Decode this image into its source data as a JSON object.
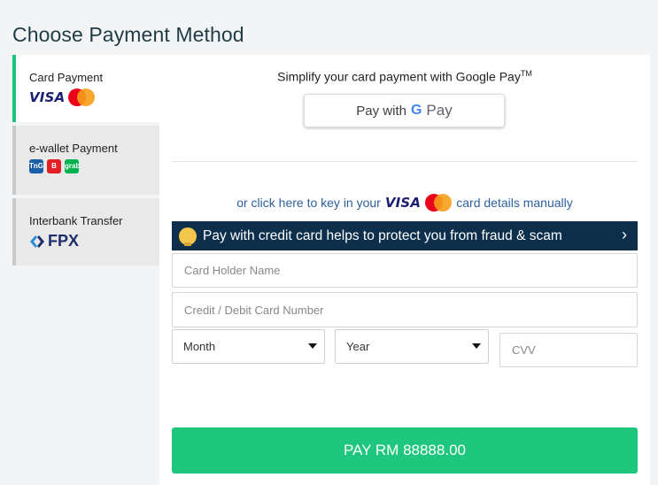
{
  "page": {
    "title": "Choose Payment Method"
  },
  "sidebar": {
    "items": [
      {
        "label": "Card Payment",
        "logos": [
          "visa",
          "mastercard"
        ],
        "active": true
      },
      {
        "label": "e-wallet Payment",
        "logos": [
          "touch-n-go",
          "boost",
          "grabpay"
        ],
        "active": false
      },
      {
        "label": "Interbank Transfer",
        "logos": [
          "fpx"
        ],
        "active": false
      }
    ],
    "visa_text": "VISA",
    "tng_text": "TnG",
    "boost_text": "B",
    "grab_text": "grab",
    "fpx_text": "FPX"
  },
  "google_pay": {
    "prompt": "Simplify your card payment with Google Pay",
    "tm": "TM",
    "button_prefix": "Pay with",
    "g": "G",
    "pay": "Pay"
  },
  "manual": {
    "prefix": "or click here to key in your",
    "visa": "VISA",
    "suffix": "card details manually"
  },
  "banner": {
    "text": "Pay with credit card helps to protect you from fraud & scam",
    "chevron": "›"
  },
  "form": {
    "holder_placeholder": "Card Holder Name",
    "card_placeholder": "Credit / Debit Card Number",
    "month": "Month",
    "year": "Year",
    "cvv_placeholder": "CVV"
  },
  "pay_button": {
    "label": "PAY RM 88888.00"
  },
  "colors": {
    "accent": "#1fc77e",
    "banner": "#0d2f4c",
    "title": "#1f3b46"
  }
}
